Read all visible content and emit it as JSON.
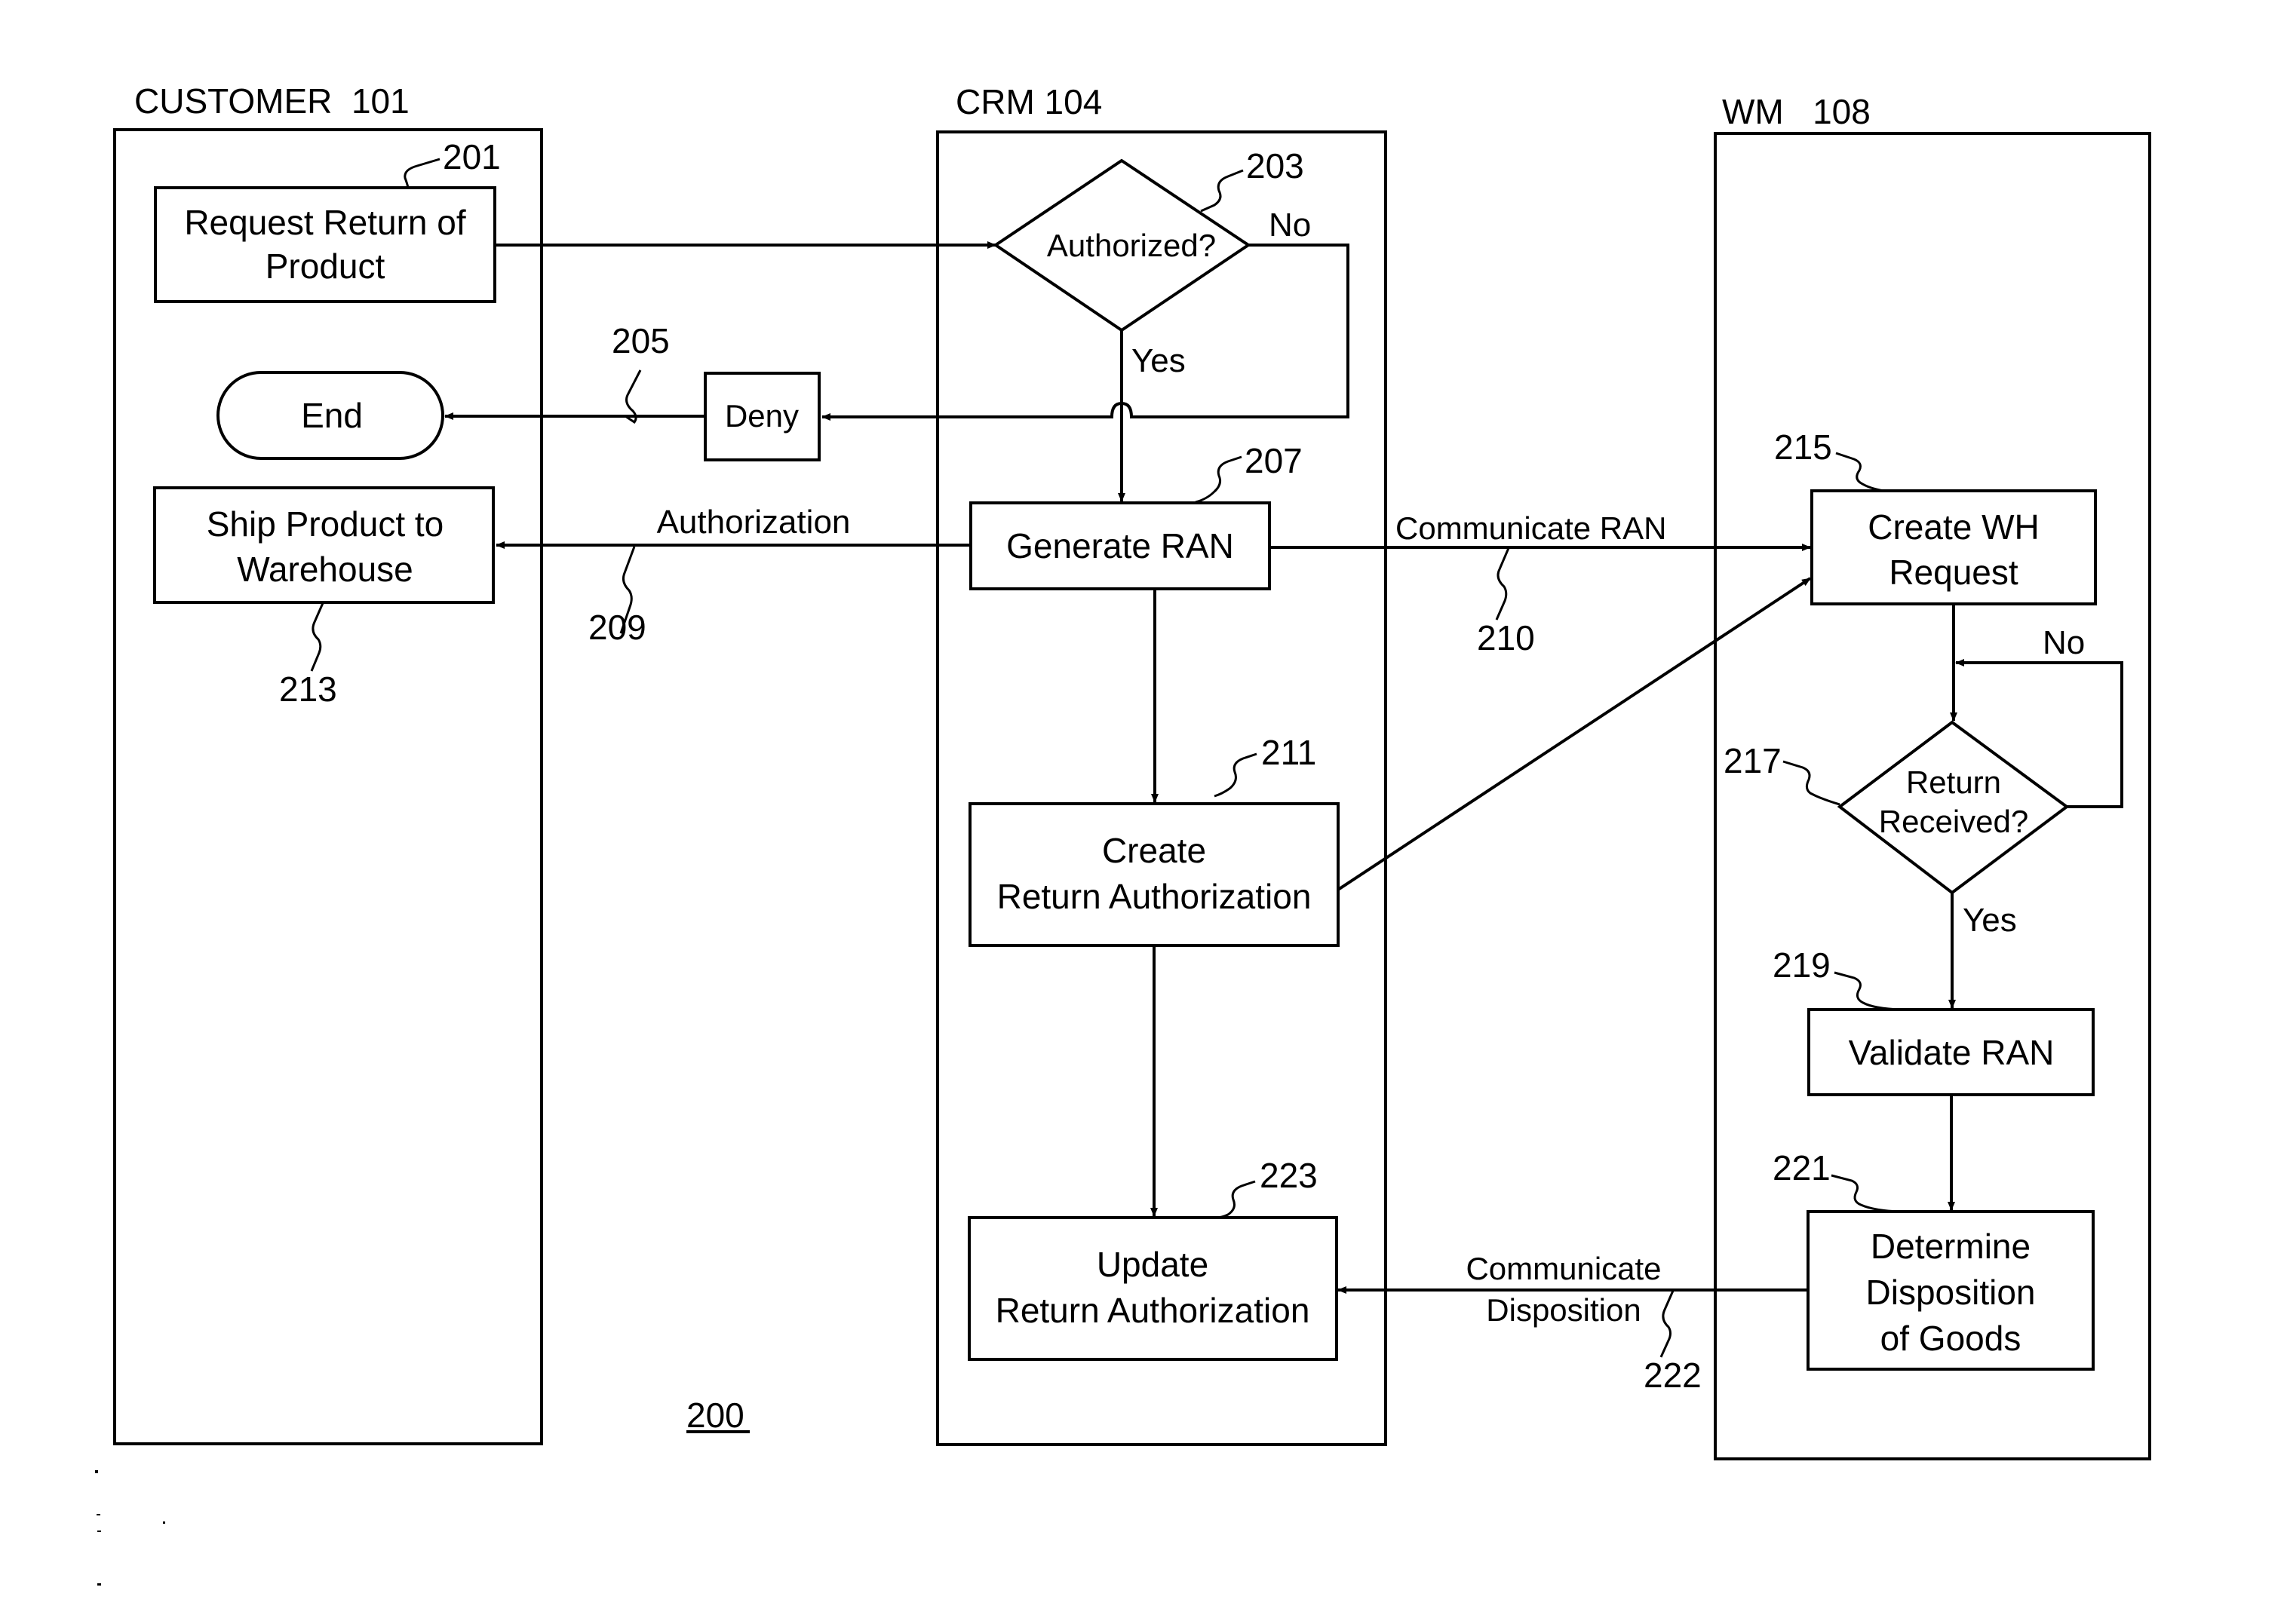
{
  "figure": {
    "number": "200",
    "lanes": {
      "customer": "CUSTOMER  101",
      "crm": "CRM 104",
      "wm": "WM   108"
    },
    "nodes": {
      "request_return": {
        "ref": "201",
        "lines": [
          "Request Return of",
          "Product"
        ]
      },
      "authorized": {
        "ref": "203",
        "lines": [
          "Authorized?"
        ]
      },
      "end": {
        "lines": [
          "End"
        ]
      },
      "deny": {
        "lines": [
          "Deny"
        ]
      },
      "generate_ran": {
        "ref": "207",
        "lines": [
          "Generate RAN"
        ]
      },
      "ship_product": {
        "ref": "213",
        "lines": [
          "Ship Product to",
          "Warehouse"
        ]
      },
      "create_return_auth": {
        "ref": "211",
        "lines": [
          "Create",
          "Return Authorization"
        ]
      },
      "update_return_auth": {
        "ref": "223",
        "lines": [
          "Update",
          "Return Authorization"
        ]
      },
      "create_wh_request": {
        "ref": "215",
        "lines": [
          "Create WH",
          "Request"
        ]
      },
      "return_received": {
        "ref": "217",
        "lines": [
          "Return",
          "Received?"
        ]
      },
      "validate_ran": {
        "ref": "219",
        "lines": [
          "Validate RAN"
        ]
      },
      "determine_disposition": {
        "ref": "221",
        "lines": [
          "Determine",
          "Disposition",
          "of Goods"
        ]
      }
    },
    "edges": {
      "authorized_no": "No",
      "authorized_yes": "Yes",
      "deny_ref": "205",
      "authorization": {
        "label": "Authorization",
        "ref": "209"
      },
      "communicate_ran": {
        "label": "Communicate RAN",
        "ref": "210"
      },
      "return_no": "No",
      "return_yes": "Yes",
      "communicate_disposition": {
        "lines": [
          "Communicate",
          "Disposition"
        ],
        "ref": "222"
      }
    }
  }
}
